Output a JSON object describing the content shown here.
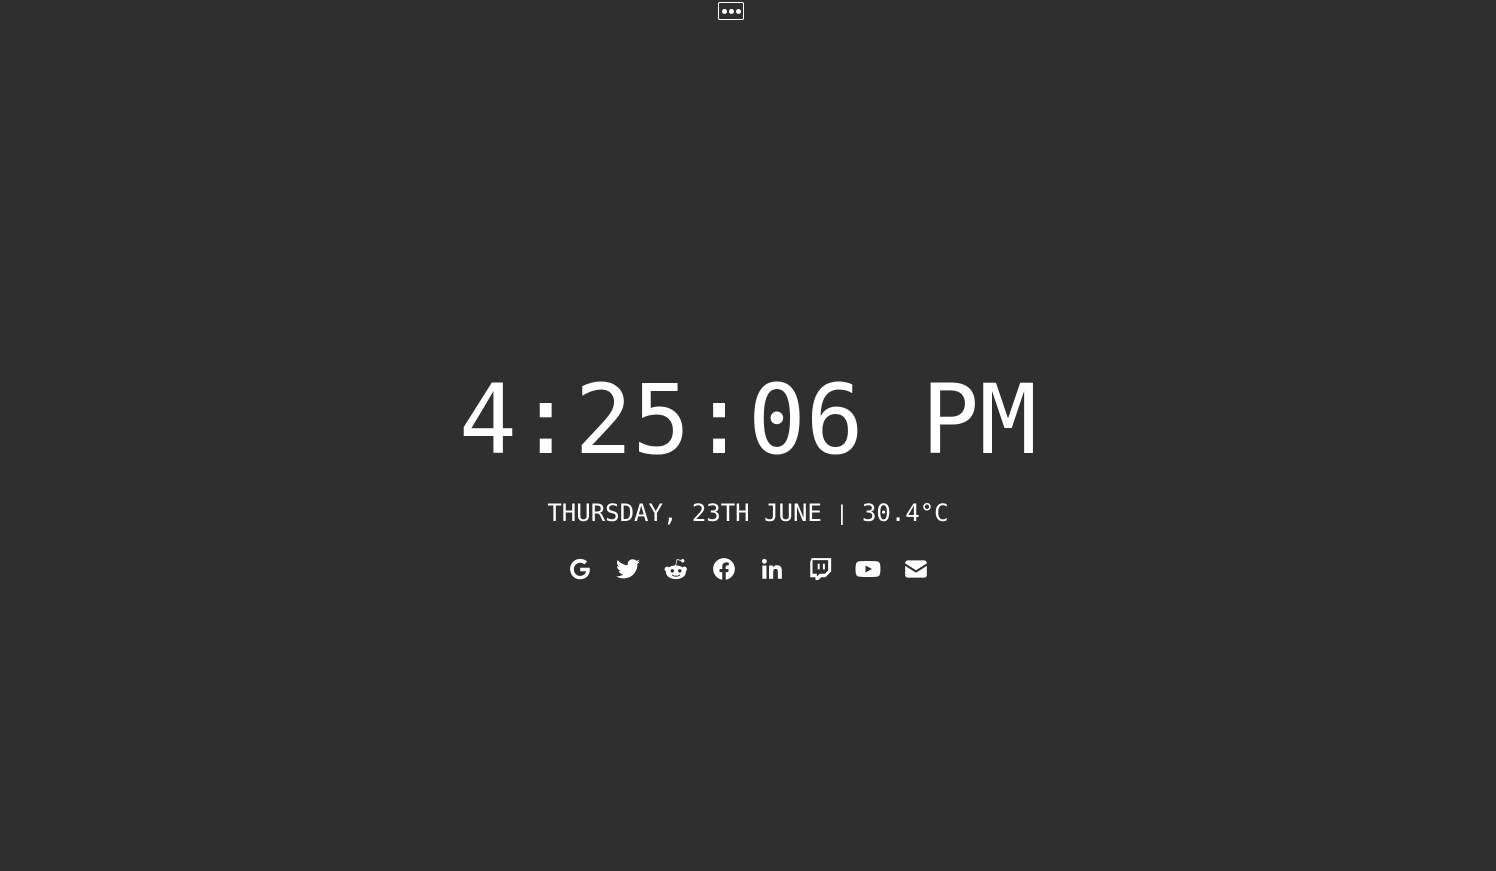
{
  "menu": {
    "icon": "ellipsis-icon"
  },
  "clock": {
    "time": "4:25:06 PM"
  },
  "info": {
    "date": "THURSDAY, 23TH JUNE",
    "separator": "|",
    "temperature": "30.4°C"
  },
  "links": [
    {
      "icon": "google-icon"
    },
    {
      "icon": "twitter-icon"
    },
    {
      "icon": "reddit-icon"
    },
    {
      "icon": "facebook-icon"
    },
    {
      "icon": "linkedin-icon"
    },
    {
      "icon": "twitch-icon"
    },
    {
      "icon": "youtube-icon"
    },
    {
      "icon": "mail-icon"
    }
  ],
  "colors": {
    "background": "#2f2f2f",
    "foreground": "#ffffff"
  }
}
